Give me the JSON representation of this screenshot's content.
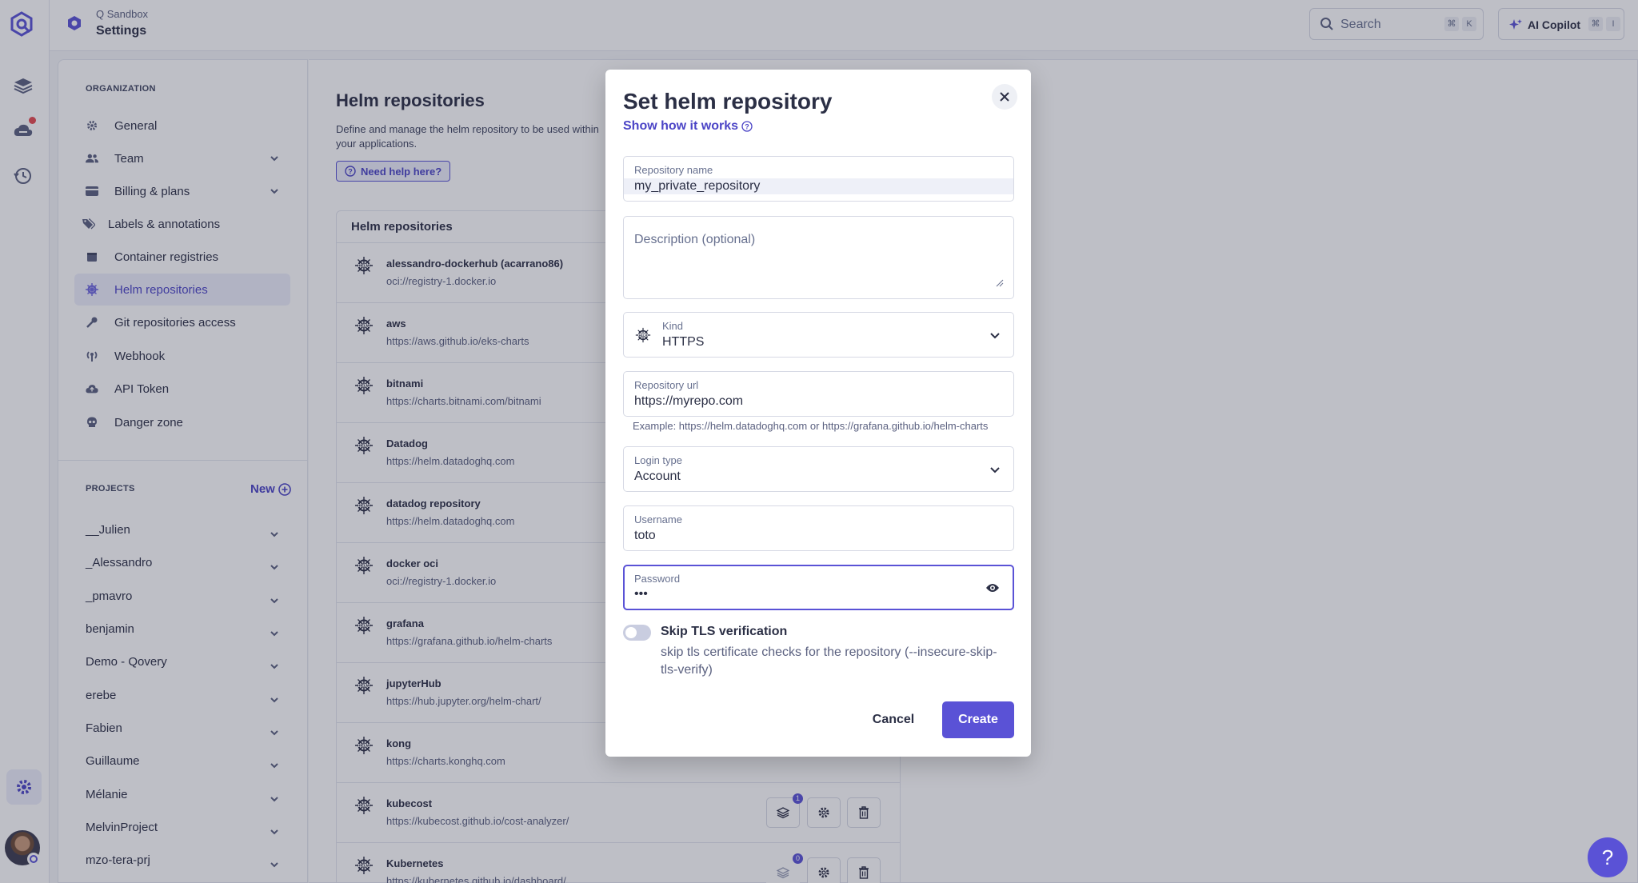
{
  "topbar": {
    "org_name": "Q Sandbox",
    "page": "Settings",
    "search_placeholder": "Search",
    "search_kbd_1": "⌘",
    "search_kbd_2": "K",
    "copilot_label": "AI Copilot",
    "copilot_kbd_1": "⌘",
    "copilot_kbd_2": "I"
  },
  "sidebar": {
    "org_section": "ORGANIZATION",
    "items": [
      {
        "label": "General",
        "icon": "gear-icon"
      },
      {
        "label": "Team",
        "icon": "users-icon"
      },
      {
        "label": "Billing & plans",
        "icon": "card-icon"
      },
      {
        "label": "Labels & annotations",
        "icon": "tags-icon"
      },
      {
        "label": "Container registries",
        "icon": "box-icon"
      },
      {
        "label": "Helm repositories",
        "icon": "helm-icon"
      },
      {
        "label": "Git repositories access",
        "icon": "key-icon"
      },
      {
        "label": "Webhook",
        "icon": "broadcast-icon"
      },
      {
        "label": "API Token",
        "icon": "cloud-upload-icon"
      },
      {
        "label": "Danger zone",
        "icon": "skull-icon"
      }
    ],
    "projects_section": "PROJECTS",
    "new_label": "New",
    "projects": [
      "__Julien",
      "_Alessandro",
      "_pmavro",
      "benjamin",
      "Demo - Qovery",
      "erebe",
      "Fabien",
      "Guillaume",
      "Mélanie",
      "MelvinProject",
      "mzo-tera-prj"
    ]
  },
  "main": {
    "title": "Helm repositories",
    "description": "Define and manage the helm repository to be used within your applications.",
    "help_button": "Need help here?",
    "table_header": "Helm repositories",
    "repos": [
      {
        "name": "alessandro-dockerhub (acarrano86)",
        "url": "oci://registry-1.docker.io"
      },
      {
        "name": "aws",
        "url": "https://aws.github.io/eks-charts"
      },
      {
        "name": "bitnami",
        "url": "https://charts.bitnami.com/bitnami"
      },
      {
        "name": "Datadog",
        "url": "https://helm.datadoghq.com"
      },
      {
        "name": "datadog repository",
        "url": "https://helm.datadoghq.com"
      },
      {
        "name": "docker oci",
        "url": "oci://registry-1.docker.io"
      },
      {
        "name": "grafana",
        "url": "https://grafana.github.io/helm-charts"
      },
      {
        "name": "jupyterHub",
        "url": "https://hub.jupyter.org/helm-chart/"
      },
      {
        "name": "kong",
        "url": "https://charts.konghq.com"
      },
      {
        "name": "kubecost",
        "url": "https://kubecost.github.io/cost-analyzer/",
        "badge": "1"
      },
      {
        "name": "Kubernetes",
        "url": "https://kubernetes.github.io/dashboard/",
        "badge": "0"
      }
    ]
  },
  "modal": {
    "title": "Set helm repository",
    "how_link": "Show how it works",
    "repo_name_label": "Repository name",
    "repo_name_value": "my_private_repository",
    "description_placeholder": "Description (optional)",
    "kind_label": "Kind",
    "kind_value": "HTTPS",
    "url_label": "Repository url",
    "url_value": "https://myrepo.com",
    "url_hint": "Example: https://helm.datadoghq.com or https://grafana.github.io/helm-charts",
    "login_label": "Login type",
    "login_value": "Account",
    "username_label": "Username",
    "username_value": "toto",
    "password_label": "Password",
    "password_value": "•••",
    "tls_title": "Skip TLS verification",
    "tls_description": "skip tls certificate checks for the repository (--insecure-skip-tls-verify)",
    "tls_enabled": false,
    "cancel_label": "Cancel",
    "create_label": "Create"
  },
  "colors": {
    "accent": "#5a52d6",
    "alert_dot": "#e6494f"
  }
}
